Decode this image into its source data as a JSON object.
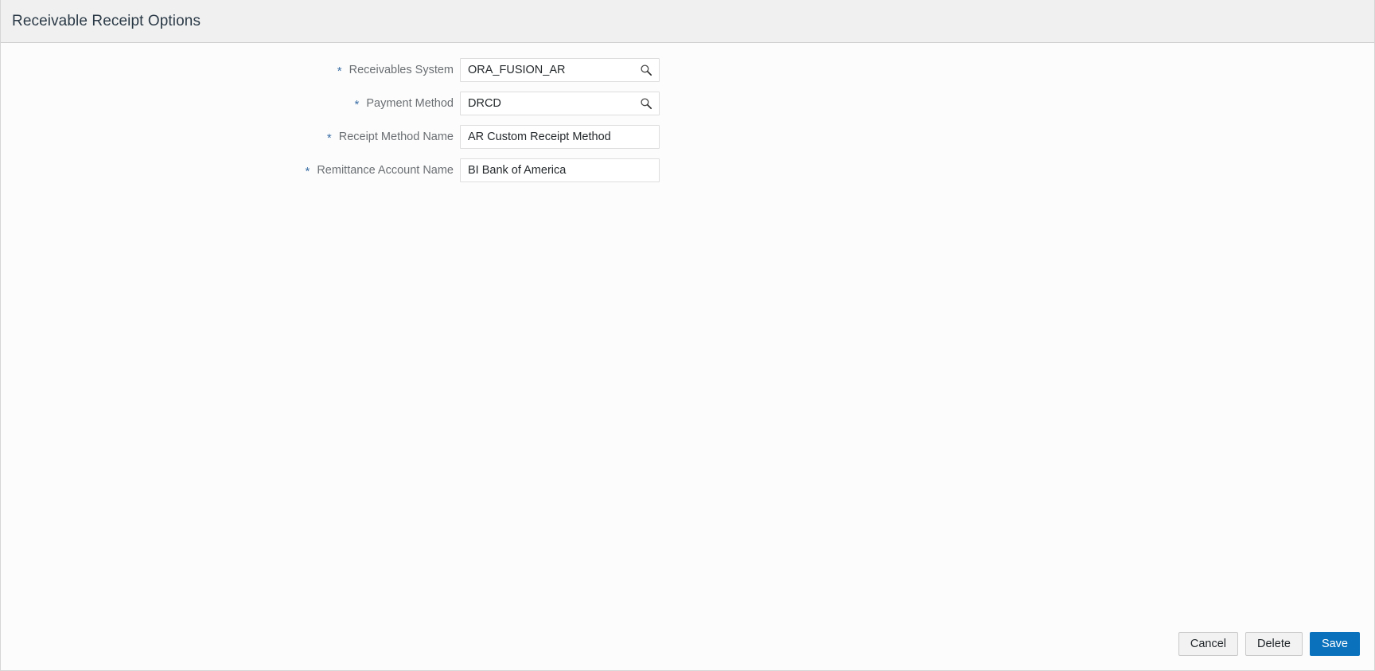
{
  "header": {
    "title": "Receivable Receipt Options"
  },
  "form": {
    "required_marker": "*",
    "fields": [
      {
        "label": "Receivables System",
        "value": "ORA_FUSION_AR",
        "placeholder": "",
        "required": true,
        "has_lov_icon": true,
        "icon": "search-icon"
      },
      {
        "label": "Payment Method",
        "value": "DRCD",
        "placeholder": "",
        "required": true,
        "has_lov_icon": true,
        "icon": "search-icon"
      },
      {
        "label": "Receipt Method Name",
        "value": "AR Custom Receipt Method",
        "placeholder": "",
        "required": true,
        "has_lov_icon": false,
        "icon": ""
      },
      {
        "label": "Remittance Account Name",
        "value": "BI Bank of America",
        "placeholder": "",
        "required": true,
        "has_lov_icon": false,
        "icon": ""
      }
    ]
  },
  "footer": {
    "cancel_label": "Cancel",
    "delete_label": "Delete",
    "save_label": "Save"
  },
  "colors": {
    "header_background": "#f0f0f0",
    "page_background": "#fcfcfc",
    "title_text": "#2b3a47",
    "label_text": "#6b6f73",
    "required_star": "#3a6ea5",
    "input_border": "#dedede",
    "primary_button": "#0a72bd",
    "secondary_button": "#f2f2f2"
  }
}
